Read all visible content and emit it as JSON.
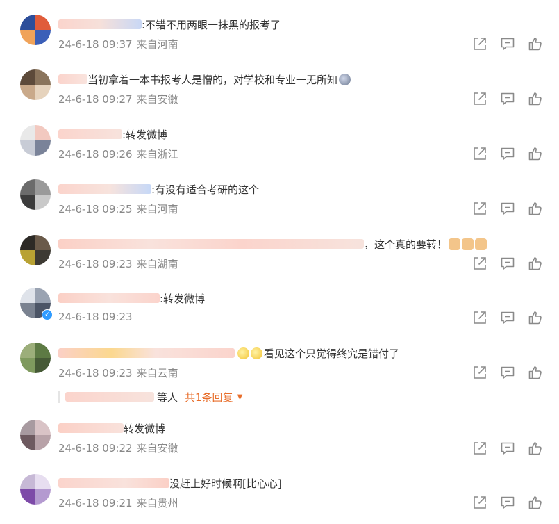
{
  "comments": [
    {
      "text": ":不错不用两眼一抹黑的报考了",
      "time": "24-6-18 09:37",
      "source": "来自河南"
    },
    {
      "text": "当初拿着一本书报考人是懵的，对学校和专业一无所知",
      "time": "24-6-18 09:27",
      "source": "来自安徽"
    },
    {
      "text": ":转发微博",
      "time": "24-6-18 09:26",
      "source": "来自浙江"
    },
    {
      "text": ":有没有适合考研的这个",
      "time": "24-6-18 09:25",
      "source": "来自河南"
    },
    {
      "text": "，这个真的要转！",
      "time": "24-6-18 09:23",
      "source": "来自湖南"
    },
    {
      "text": ":转发微博",
      "time": "24-6-18 09:23",
      "source": ""
    },
    {
      "text": "看见这个只觉得终究是错付了",
      "time": "24-6-18 09:23",
      "source": "来自云南"
    },
    {
      "text": "转发微博",
      "time": "24-6-18 09:22",
      "source": "来自安徽"
    },
    {
      "text": "没赶上好时候啊[比心心]",
      "time": "24-6-18 09:21",
      "source": "来自贵州"
    }
  ],
  "reply_summary": {
    "suffix": "等人",
    "count_label": "共1条回复"
  },
  "icons": {
    "share": "share-icon",
    "comment": "comment-icon",
    "like": "like-icon"
  },
  "colors": {
    "meta": "#888888",
    "accent": "#e86e2b",
    "icon": "#8a8a8a"
  }
}
